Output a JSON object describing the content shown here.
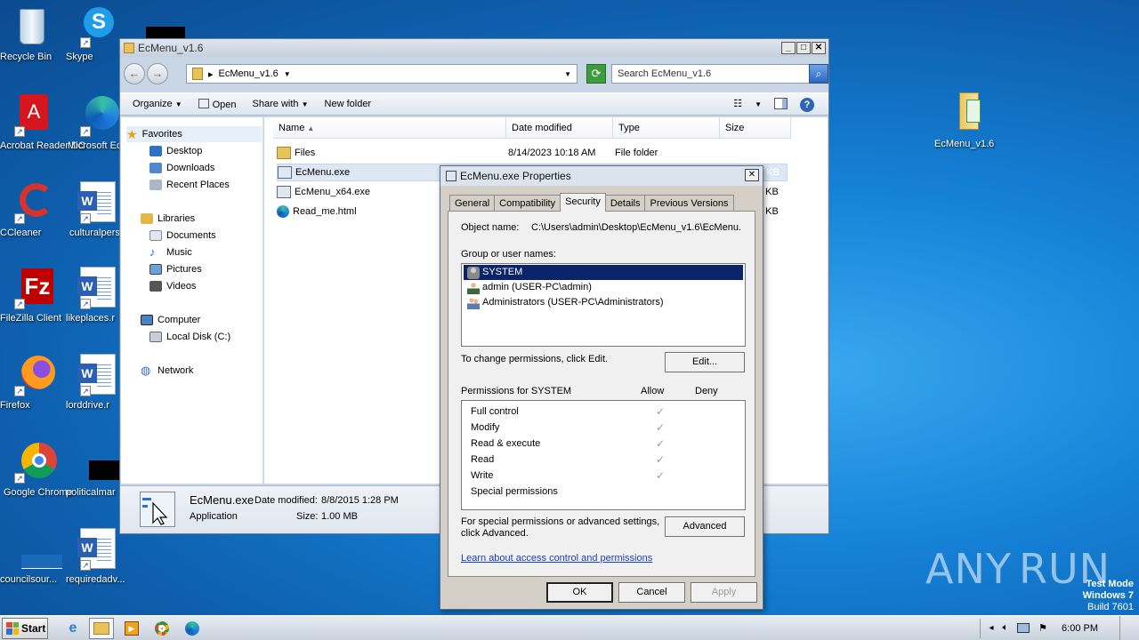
{
  "desktop": {
    "icons": [
      {
        "label": "Recycle Bin"
      },
      {
        "label": "Skype"
      },
      {
        "label": "Acrobat Reader DC"
      },
      {
        "label": "Microsoft Ec"
      },
      {
        "label": "CCleaner"
      },
      {
        "label": "culturalpers"
      },
      {
        "label": "FileZilla Client"
      },
      {
        "label": "likeplaces.r"
      },
      {
        "label": "Firefox"
      },
      {
        "label": "lorddrive.r"
      },
      {
        "label": "Google Chrome"
      },
      {
        "label": "politicalmar"
      },
      {
        "label": "councilsour..."
      },
      {
        "label": "requiredadv..."
      },
      {
        "label": "EcMenu_v1.6"
      }
    ],
    "watermark": {
      "brand": "ANY",
      "brand2": "RUN",
      "line1": "Test Mode",
      "line2": "Windows 7",
      "line3": "Build 7601"
    }
  },
  "explorer": {
    "title": "EcMenu_v1.6",
    "address": "EcMenu_v1.6",
    "search_placeholder": "Search EcMenu_v1.6",
    "toolbar": {
      "organize": "Organize",
      "open": "Open",
      "share_with": "Share with",
      "new_folder": "New folder"
    },
    "nav": {
      "favorites": "Favorites",
      "desktop": "Desktop",
      "downloads": "Downloads",
      "recent": "Recent Places",
      "libraries": "Libraries",
      "documents": "Documents",
      "music": "Music",
      "pictures": "Pictures",
      "videos": "Videos",
      "computer": "Computer",
      "local_disk": "Local Disk (C:)",
      "network": "Network"
    },
    "columns": {
      "name": "Name",
      "date": "Date modified",
      "type": "Type",
      "size": "Size"
    },
    "files": [
      {
        "name": "Files",
        "date": "8/14/2023 10:18 AM",
        "type": "File folder",
        "size": ""
      },
      {
        "name": "EcMenu.exe",
        "date": "",
        "type": "",
        "size": "7 KB"
      },
      {
        "name": "EcMenu_x64.exe",
        "date": "",
        "type": "",
        "size": "4 KB"
      },
      {
        "name": "Read_me.html",
        "date": "",
        "type": "",
        "size": "1 KB"
      }
    ],
    "details": {
      "filename": "EcMenu.exe",
      "date_label": "Date modified:",
      "date_value": "8/8/2015 1:28 PM",
      "type": "Application",
      "size_label": "Size:",
      "size_value": "1.00 MB"
    }
  },
  "props": {
    "title": "EcMenu.exe Properties",
    "tabs": [
      "General",
      "Compatibility",
      "Security",
      "Details",
      "Previous Versions"
    ],
    "object_label": "Object name:",
    "object_value": "C:\\Users\\admin\\Desktop\\EcMenu_v1.6\\EcMenu.",
    "group_label": "Group or user names:",
    "users": [
      "SYSTEM",
      "admin (USER-PC\\admin)",
      "Administrators (USER-PC\\Administrators)"
    ],
    "change_text": "To change permissions, click Edit.",
    "edit_button": "Edit...",
    "perms_for": "Permissions for SYSTEM",
    "allow": "Allow",
    "deny": "Deny",
    "permissions": [
      "Full control",
      "Modify",
      "Read & execute",
      "Read",
      "Write",
      "Special permissions"
    ],
    "check": "✓",
    "special_text_1": "For special permissions or advanced settings,",
    "special_text_2": "click Advanced.",
    "advanced_button": "Advanced",
    "link": "Learn about access control and permissions",
    "ok": "OK",
    "cancel": "Cancel",
    "apply": "Apply"
  },
  "taskbar": {
    "start": "Start",
    "time": "6:00 PM"
  }
}
